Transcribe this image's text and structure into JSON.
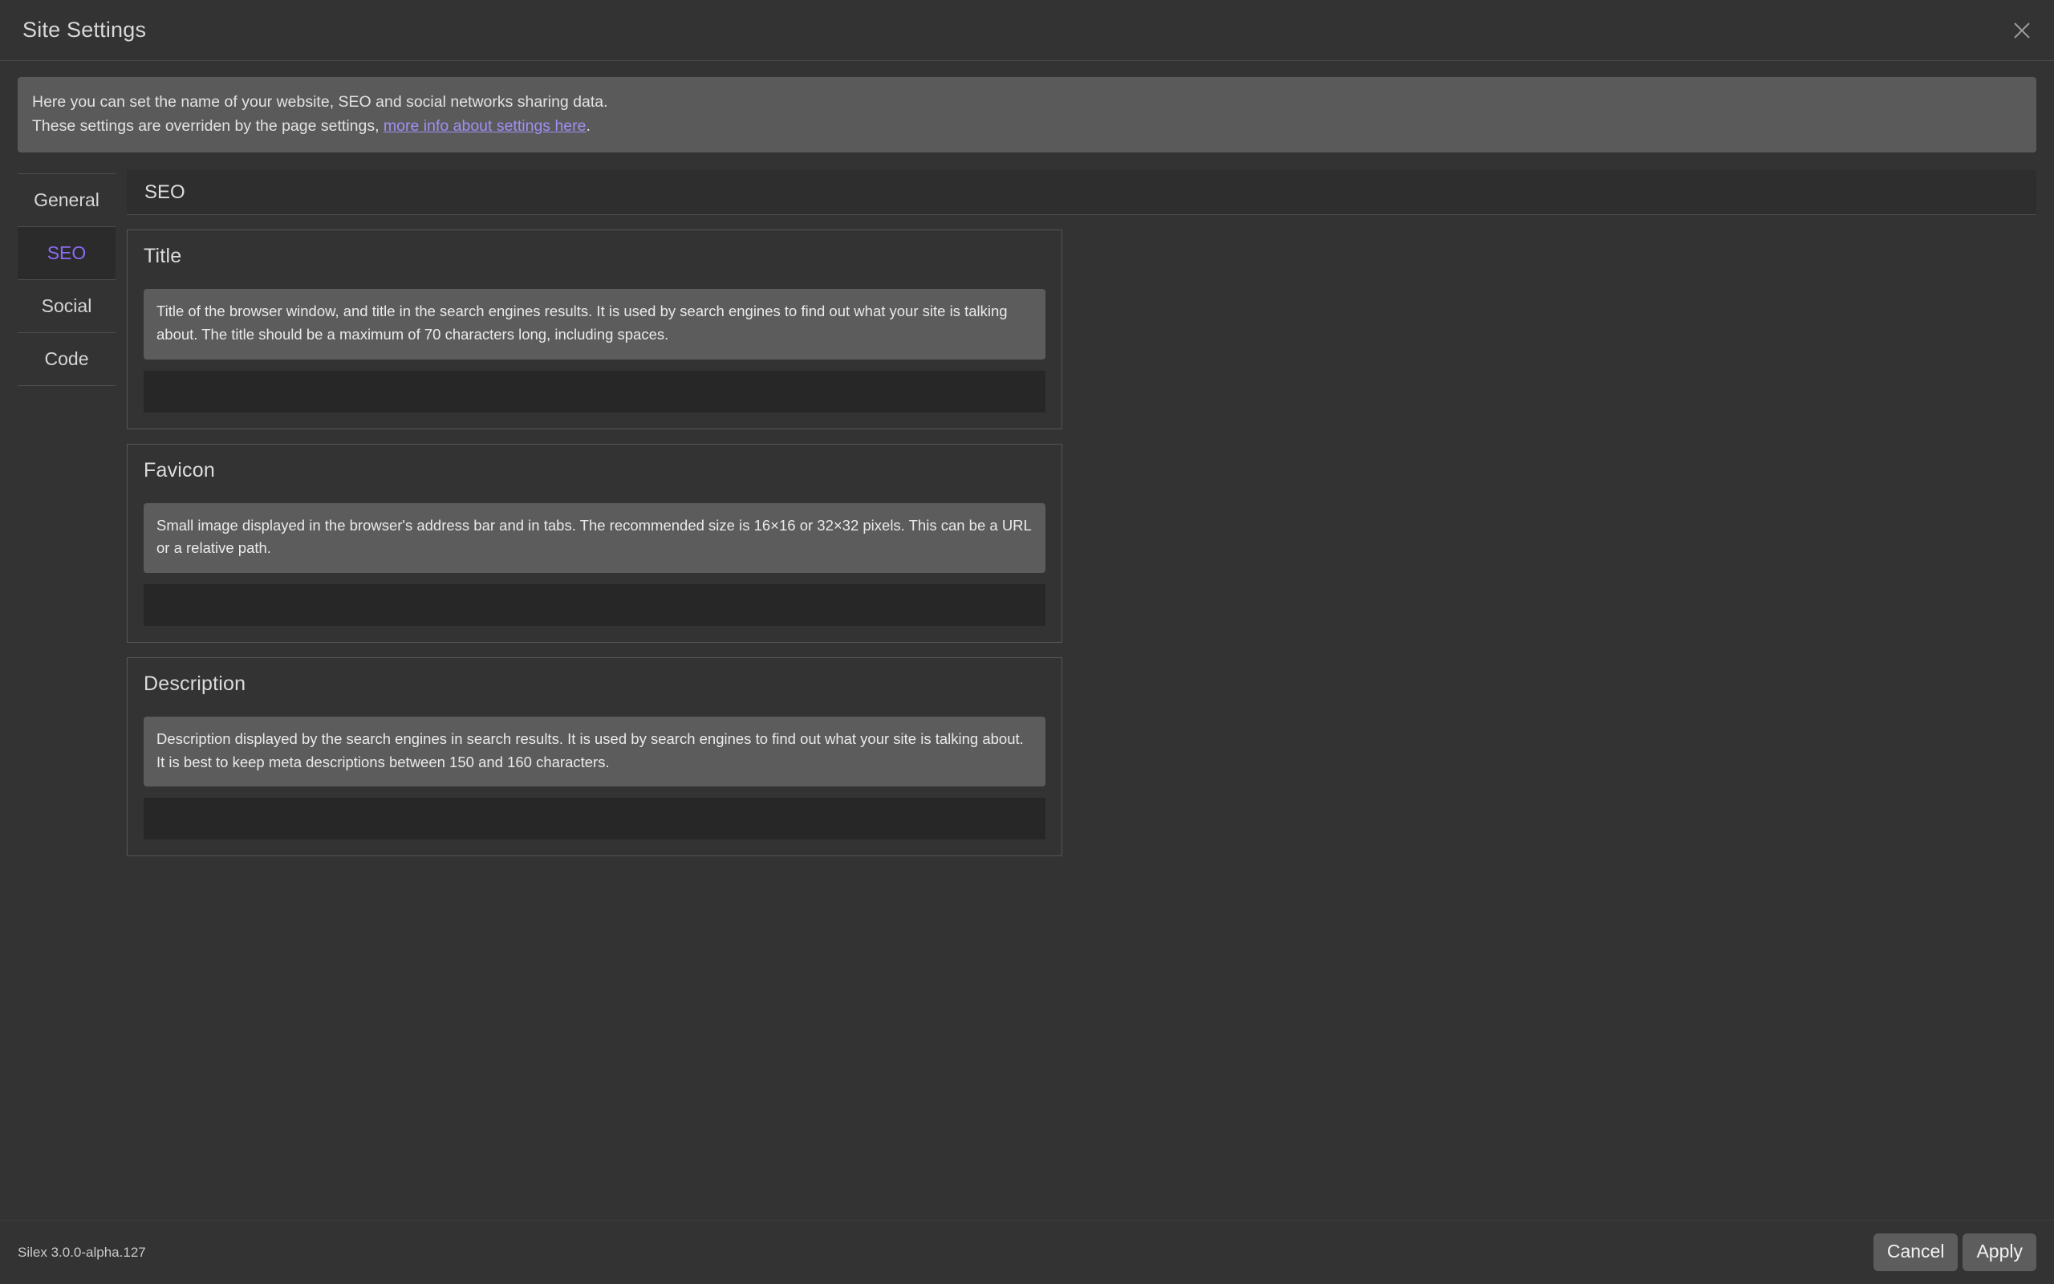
{
  "window": {
    "title": "Site Settings",
    "close_icon": "close-icon"
  },
  "banner": {
    "line1": "Here you can set the name of your website, SEO and social networks sharing data.",
    "line2_prefix": "These settings are overriden by the page settings, ",
    "link_text": "more info about settings here",
    "line2_suffix": ".",
    "link_color": "#a08ff2",
    "background": "#5a5a5a"
  },
  "sidebar": {
    "items": [
      {
        "label": "General",
        "active": false
      },
      {
        "label": "SEO",
        "active": true
      },
      {
        "label": "Social",
        "active": false
      },
      {
        "label": "Code",
        "active": false
      }
    ],
    "active_color": "#8b6cf5"
  },
  "panel": {
    "header": "SEO",
    "fieldsets": [
      {
        "legend": "Title",
        "help": "Title of the browser window, and title in the search engines results. It is used by search engines to find out what your site is talking about. The title should be a maximum of 70 characters long, including spaces.",
        "value": "",
        "placeholder": ""
      },
      {
        "legend": "Favicon",
        "help": "Small image displayed in the browser's address bar and in tabs. The recommended size is 16×16 or 32×32 pixels. This can be a URL or a relative path.",
        "value": "",
        "placeholder": ""
      },
      {
        "legend": "Description",
        "help": "Description displayed by the search engines in search results. It is used by search engines to find out what your site is talking about. It is best to keep meta descriptions between 150 and 160 characters.",
        "value": "",
        "placeholder": ""
      }
    ]
  },
  "footer": {
    "version": "Silex 3.0.0-alpha.127",
    "cancel_label": "Cancel",
    "apply_label": "Apply"
  }
}
